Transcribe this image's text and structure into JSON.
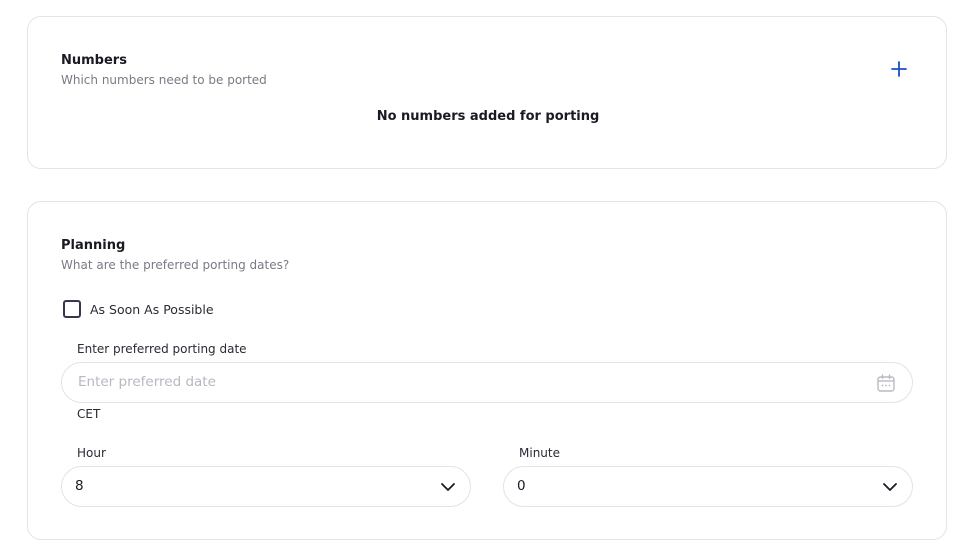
{
  "numbers": {
    "title": "Numbers",
    "subtitle": "Which numbers need to be ported",
    "empty_message": "No numbers added for porting",
    "add_icon": "plus-icon",
    "accent_color": "#1a4fc9"
  },
  "planning": {
    "title": "Planning",
    "subtitle": "What are the preferred porting dates?",
    "asap": {
      "label": "As Soon As Possible",
      "checked": false
    },
    "date": {
      "label": "Enter preferred porting date",
      "placeholder": "Enter preferred date",
      "value": "",
      "icon": "calendar-icon"
    },
    "timezone": "CET",
    "hour": {
      "label": "Hour",
      "value": "8"
    },
    "minute": {
      "label": "Minute",
      "value": "0"
    }
  }
}
